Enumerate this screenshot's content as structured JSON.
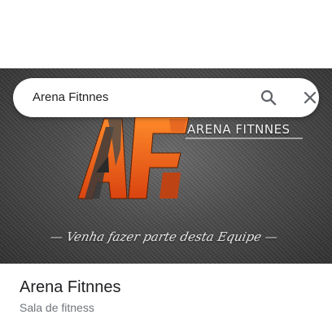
{
  "search": {
    "query": "Arena Fitnnes"
  },
  "hero": {
    "brand_text": "ARENA FITNNES",
    "tagline": "Venha fazer parte desta Equipe",
    "logo_letters": "AF",
    "accent_color": "#f26a1b"
  },
  "place": {
    "name": "Arena Fitnnes",
    "category": "Sala de fitness"
  },
  "icons": {
    "search": "search-icon",
    "close": "close-icon"
  }
}
